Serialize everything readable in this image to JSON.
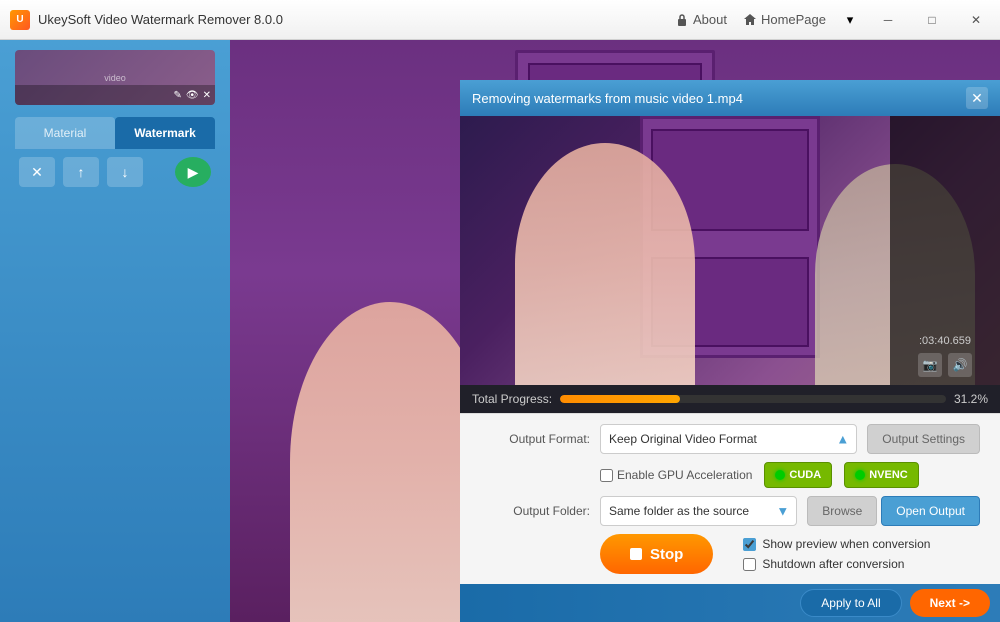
{
  "titlebar": {
    "app_name": "UkeySoft Video Watermark Remover 8.0.0",
    "about_label": "About",
    "homepage_label": "HomePage"
  },
  "sidebar": {
    "material_tab": "Material",
    "watermark_tab": "Watermark",
    "actions": {
      "delete": "✕",
      "up": "↑",
      "down": "↓"
    }
  },
  "dialog": {
    "title": "Removing watermarks from music video 1.mp4",
    "progress": {
      "label": "Total Progress:",
      "percent": "31.2%",
      "fill_width": "31.2"
    }
  },
  "controls": {
    "output_format_label": "Output Format:",
    "output_format_value": "Keep Original Video Format",
    "output_settings_label": "Output Settings",
    "gpu_label": "Enable GPU Acceleration",
    "cuda_label": "CUDA",
    "nvenc_label": "NVENC",
    "output_folder_label": "Output Folder:",
    "output_folder_value": "Same folder as the source",
    "browse_label": "Browse",
    "open_output_label": "Open Output",
    "stop_label": "Stop",
    "show_preview_label": "Show preview when conversion",
    "shutdown_label": "Shutdown after conversion"
  },
  "footer": {
    "apply_all_label": "Apply to All",
    "next_label": "Next ->"
  },
  "time": {
    "display": ":03:40.659"
  }
}
